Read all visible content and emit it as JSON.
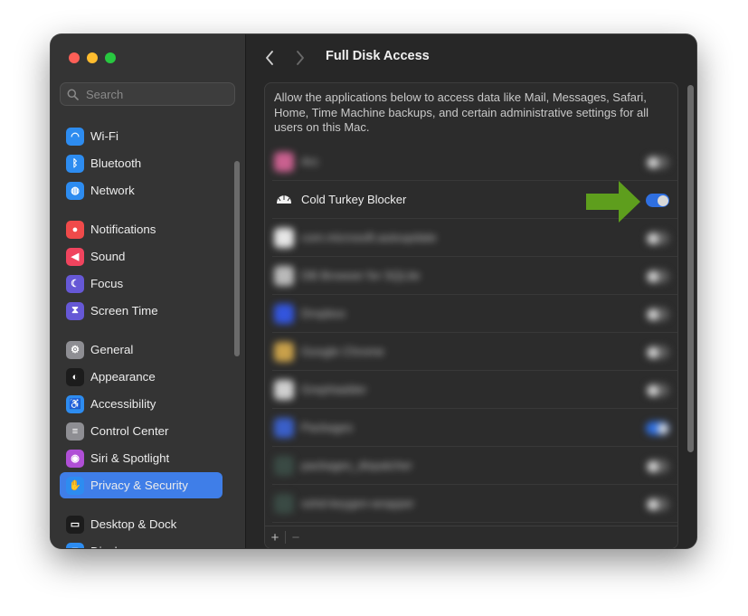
{
  "sidebar": {
    "search_placeholder": "Search",
    "items": [
      {
        "label": "Wi-Fi",
        "icon": "wifi-icon",
        "color": "#2d8cf0"
      },
      {
        "label": "Bluetooth",
        "icon": "bluetooth-icon",
        "color": "#2d8cf0"
      },
      {
        "label": "Network",
        "icon": "globe-icon",
        "color": "#2d8cf0"
      },
      {
        "label": "Notifications",
        "icon": "bell-icon",
        "color": "#f04a4a"
      },
      {
        "label": "Sound",
        "icon": "speaker-icon",
        "color": "#f0445e"
      },
      {
        "label": "Focus",
        "icon": "moon-icon",
        "color": "#6658d6"
      },
      {
        "label": "Screen Time",
        "icon": "hourglass-icon",
        "color": "#6658d6"
      },
      {
        "label": "General",
        "icon": "gear-icon",
        "color": "#8e8e93"
      },
      {
        "label": "Appearance",
        "icon": "appearance-icon",
        "color": "#1c1c1c"
      },
      {
        "label": "Accessibility",
        "icon": "accessibility-icon",
        "color": "#2d8cf0"
      },
      {
        "label": "Control Center",
        "icon": "control-center-icon",
        "color": "#8e8e93"
      },
      {
        "label": "Siri & Spotlight",
        "icon": "siri-icon",
        "color": "#b04fd6"
      },
      {
        "label": "Privacy & Security",
        "icon": "hand-icon",
        "color": "#2d8cf0"
      },
      {
        "label": "Desktop & Dock",
        "icon": "dock-icon",
        "color": "#1c1c1c"
      },
      {
        "label": "Displays",
        "icon": "display-icon",
        "color": "#2d8cf0"
      }
    ]
  },
  "main": {
    "title": "Full Disk Access",
    "description": "Allow the applications below to access data like Mail, Messages, Safari, Home, Time Machine backups, and certain administrative settings for all users on this Mac.",
    "apps": [
      {
        "name": "Arc",
        "enabled": false,
        "blurred": true,
        "icon_color": "#c9608f"
      },
      {
        "name": "Cold Turkey Blocker",
        "enabled": true,
        "blurred": false,
        "icon_color": "#ffffff"
      },
      {
        "name": "com.microsoft.autoupdate",
        "enabled": false,
        "blurred": true,
        "icon_color": "#e6e6e6"
      },
      {
        "name": "DB Browser for SQLite",
        "enabled": false,
        "blurred": true,
        "icon_color": "#b9b9b9"
      },
      {
        "name": "Dropbox",
        "enabled": false,
        "blurred": true,
        "icon_color": "#3355dd"
      },
      {
        "name": "Google Chrome",
        "enabled": false,
        "blurred": true,
        "icon_color": "#c8a04a"
      },
      {
        "name": "Grephiadder",
        "enabled": false,
        "blurred": true,
        "icon_color": "#cfcfcf"
      },
      {
        "name": "Packages",
        "enabled": true,
        "blurred": true,
        "icon_color": "#3a5fc8"
      },
      {
        "name": "packages_dispatcher",
        "enabled": false,
        "blurred": true,
        "icon_color": "#3a4a44"
      },
      {
        "name": "sshd-keygen-wrapper",
        "enabled": false,
        "blurred": true,
        "icon_color": "#3a4a44"
      }
    ],
    "add_label": "+",
    "remove_label": "−"
  },
  "annotation": {
    "color": "#5e9e1d"
  }
}
